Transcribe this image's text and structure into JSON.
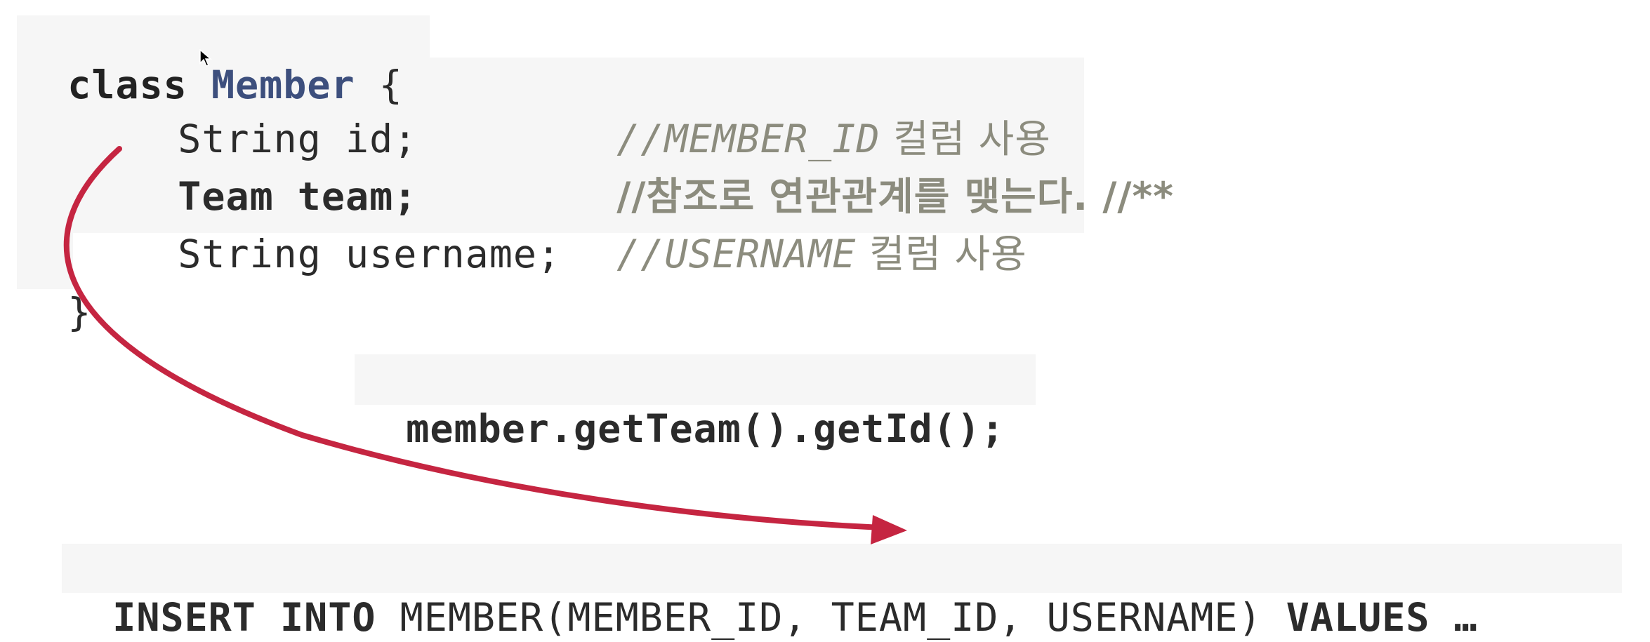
{
  "code": {
    "class_keyword": "class",
    "class_name": "Member",
    "open_brace": "{",
    "line_id": {
      "code": "String id;",
      "comment_prefix": "//MEMBER_ID",
      "comment_text": " 컬럼 사용"
    },
    "line_team": {
      "code": "Team team;",
      "comment": "//참조로 연관관계를 맺는다. //**"
    },
    "line_username": {
      "code": "String username;",
      "comment_prefix": "//USERNAME",
      "comment_text": " 컬럼 사용"
    },
    "close_brace": "}"
  },
  "call_expression": "member.getTeam().getId();",
  "sql": {
    "insert_into": "INSERT INTO",
    "table_part": " MEMBER(MEMBER_ID, TEAM_ID, USERNAME) ",
    "values": "VALUES …"
  },
  "colors": {
    "arrow": "#c52541",
    "class_name": "#3d4f7d",
    "comment": "#8c8c7e"
  }
}
